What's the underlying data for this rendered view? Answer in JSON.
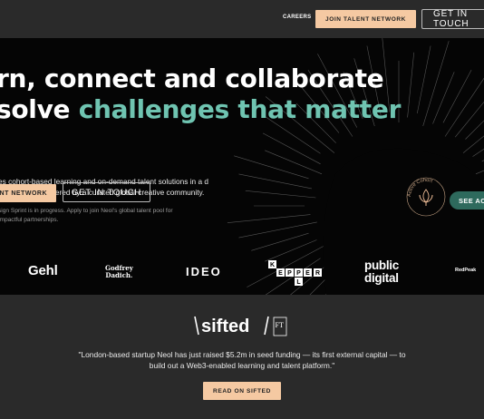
{
  "header": {
    "nav_careers": "CAREERS",
    "join_button": "JOIN TALENT NETWORK",
    "contact_button": "GET IN TOUCH"
  },
  "hero": {
    "headline_line1": "rn, connect and collaborate",
    "headline_line2_prefix": "solve ",
    "headline_line2_accent": "challenges that matter",
    "description": "es cohort-based learning and on-demand talent solutions in a d way. We are powered by a curated global creative community.",
    "talent_button": "ENT NETWORK",
    "contact_button": "GET IN TOUCH",
    "note": "sign Sprint is in progress. Apply to join Neol's global talent pool for impactful partnerships.",
    "badge_text": "Active Cohort",
    "see_button": "SEE ACTI",
    "accent_color": "#6fc4b1",
    "cta_color": "#f5c9a2"
  },
  "partners": {
    "gehl": "Gehl",
    "godfrey_line1": "Godfrey",
    "godfrey_line2": "Dadich.",
    "ideo": "IDEO",
    "keppler_letters": [
      "K",
      "E",
      "P",
      "P",
      "L",
      "E",
      "R"
    ],
    "public_line1": "public",
    "public_line2": "digital",
    "redpeak": "RedPeak"
  },
  "press": {
    "logo_left": "sifted",
    "logo_right": "FT",
    "quote": "\"London-based startup Neol has just raised $5.2m in seed funding — its first external capital — to build out a Web3-enabled learning and talent platform.\"",
    "read_button": "READ ON SIFTED"
  }
}
